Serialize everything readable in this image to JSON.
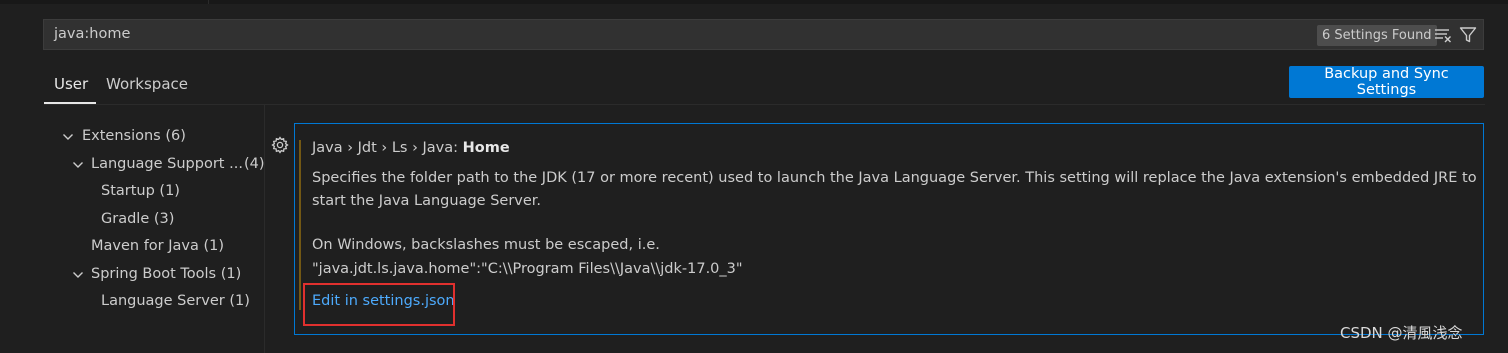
{
  "search": {
    "query": "java:home",
    "results_badge": "6 Settings Found"
  },
  "tabs": [
    {
      "label": "User",
      "active": true
    },
    {
      "label": "Workspace",
      "active": false
    }
  ],
  "sync_button": "Backup and Sync Settings",
  "toc": [
    {
      "label": "Extensions (6)",
      "expanded": true
    },
    {
      "label": "Language Support ...",
      "count": "(4)",
      "expanded": true
    },
    {
      "label": "Startup (1)"
    },
    {
      "label": "Gradle (3)"
    },
    {
      "label": "Maven for Java (1)"
    },
    {
      "label": "Spring Boot Tools (1)",
      "expanded": true
    },
    {
      "label": "Language Server (1)"
    }
  ],
  "setting": {
    "breadcrumb": "Java › Jdt › Ls › Java: ",
    "name": "Home",
    "description_line1": "Specifies the folder path to the JDK (17 or more recent) used to launch the Java Language Server. This setting will replace the Java extension's embedded JRE to",
    "description_line2": "start the Java Language Server.",
    "windows_note": "On Windows, backslashes must be escaped, i.e.",
    "example": "\"java.jdt.ls.java.home\":\"C:\\\\Program Files\\\\Java\\\\jdk-17.0_3\"",
    "edit_link": "Edit in settings.json"
  },
  "watermark": "CSDN @清風浅念",
  "colors": {
    "accent": "#0078d4",
    "link": "#4daafc",
    "highlight_box": "#e0302e"
  },
  "icons": [
    "clear-filter-icon",
    "filter-icon",
    "chevron-down-icon",
    "gear-icon"
  ]
}
